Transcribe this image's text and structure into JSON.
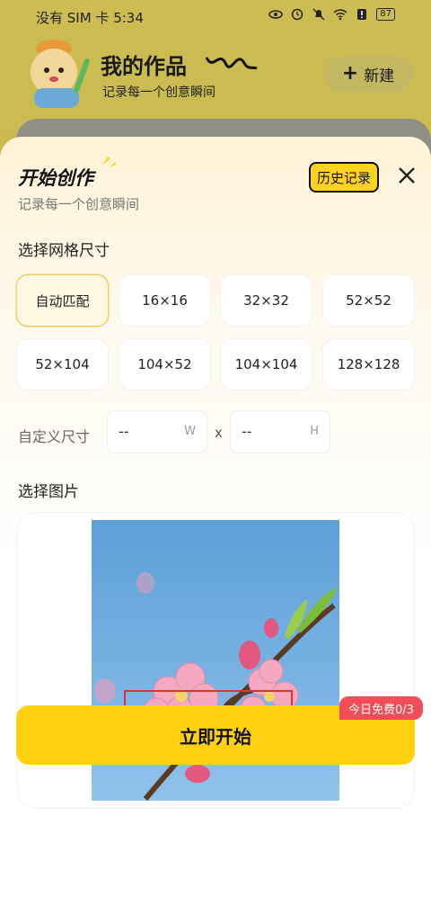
{
  "status": {
    "carrier_time": "没有 SIM 卡 5:34",
    "battery": "87"
  },
  "header": {
    "title": "我的作品",
    "subtitle": "记录每一个创意瞬间",
    "new_label": "新建"
  },
  "sheet": {
    "title": "开始创作",
    "subtitle": "记录每一个创意瞬间",
    "history_label": "历史记录",
    "grid_section_label": "选择网格尺寸",
    "grid_options": [
      "自动匹配",
      "16×16",
      "32×32",
      "52×52",
      "52×104",
      "104×52",
      "104×104",
      "128×128"
    ],
    "selected_option": "自动匹配",
    "custom_size": {
      "label": "自定义尺寸",
      "width_value": "--",
      "width_unit": "W",
      "separator": "x",
      "height_value": "--",
      "height_unit": "H"
    },
    "image_section_label": "选择图片",
    "start_label": "立即开始",
    "free_badge": "今日免费0/3"
  },
  "colors": {
    "accent": "#ffd10f",
    "selected_border": "#f3cd57",
    "badge": "#f04d57"
  }
}
